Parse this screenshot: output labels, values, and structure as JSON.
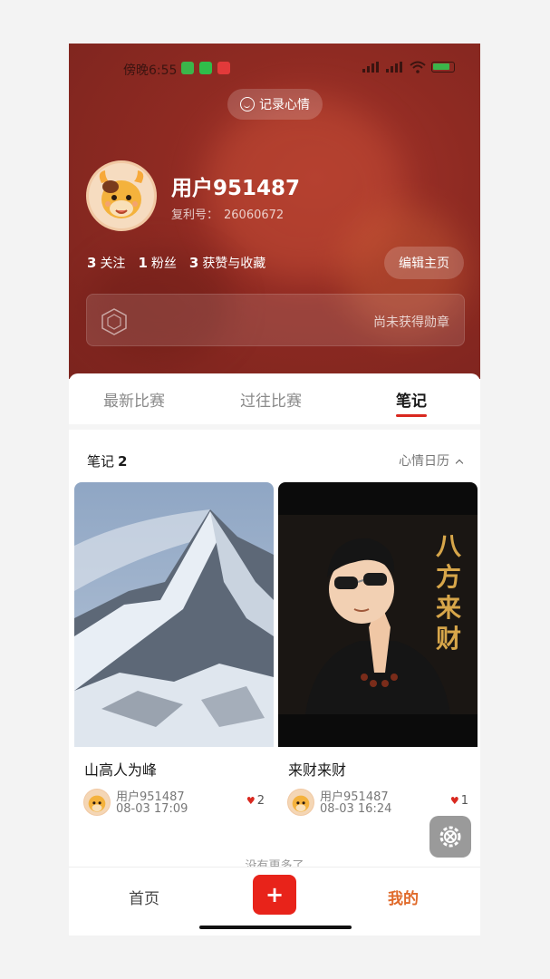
{
  "status_bar": {
    "time": "傍晚6:55"
  },
  "header": {
    "mood_button": "记录心情",
    "username": "用户951487",
    "id_label": "复利号：",
    "id_value": "26060672",
    "stats": [
      {
        "count": "3",
        "label": "关注"
      },
      {
        "count": "1",
        "label": "粉丝"
      },
      {
        "count": "3",
        "label": "获赞与收藏"
      }
    ],
    "edit_button": "编辑主页",
    "medal_text": "尚未获得勋章"
  },
  "tabs": [
    {
      "label": "最新比赛",
      "active": false
    },
    {
      "label": "过往比赛",
      "active": false
    },
    {
      "label": "笔记",
      "active": true
    }
  ],
  "notes": {
    "title": "笔记",
    "count": "2",
    "calendar_label": "心情日历",
    "cards": [
      {
        "title": "山高人为峰",
        "author": "用户951487",
        "date": "08-03 17:09",
        "likes": "2",
        "image": "snowy-mountain"
      },
      {
        "title": "来财来财",
        "author": "用户951487",
        "date": "08-03 16:24",
        "likes": "1",
        "image": "cartoon-boy-praying",
        "overlay_text": "八方来财"
      }
    ],
    "no_more": "没有更多了"
  },
  "bottom_nav": {
    "home": "首页",
    "plus": "+",
    "mine": "我的"
  },
  "colors": {
    "header_red": "#8e2a22",
    "accent_red": "#d9281f",
    "active_orange": "#e06a2a"
  }
}
